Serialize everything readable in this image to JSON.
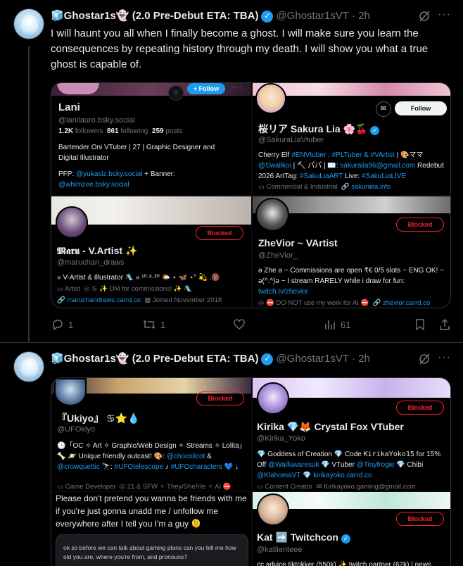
{
  "tweets": [
    {
      "display_name": "🧊Ghostar1s👻 (2.0 Pre-Debut ETA: TBA)",
      "handle": "@Ghostar1sVT",
      "time": "· 2h",
      "text": "I will haunt you all when I finally become a ghost. I will make sure you learn the consequences by repeating history through my death. I will show you what a true ghost is capable of.",
      "stats": {
        "replies": "1",
        "retweets": "1",
        "likes": "",
        "views": "61"
      },
      "cards": [
        {
          "name": "Lani",
          "handle": "@lanilauro.bsky.social",
          "followers": "1.2K",
          "followers_label": "followers",
          "following": "861",
          "following_label": "following",
          "posts": "259",
          "posts_label": "posts",
          "bio": "Bartender Oni VTuber | 27 | Graphic Designer and Digital Illustrator",
          "pfp_prefix": "PFP:",
          "pfp_link": "@yukaslz.bsky.social",
          "banner_prefix": "+ Banner:",
          "banner_link": "@whimzee.bsky.social",
          "follow_label": "+ Follow"
        },
        {
          "name": "桜リア Sakura Lia 🌸🍒",
          "handle": "@SakuraLiaVtuber",
          "bio_a": "Cherry Elf ",
          "tags_1": "#ENVtuber , #PLTuber & #VArtist",
          "bio_b": " | 🎨ママ ",
          "link_1": "@Swallkoi",
          "bio_c": " | 🔨 パパ | ✉️: ",
          "email": "sakuralia96@gmail.com",
          "bio_d": " Redebut 2026 ArtTag: ",
          "tags_2": "#SakuLiaART",
          "bio_e": " Live: ",
          "tags_3": "#SakuLiaLIVE",
          "meta_1": "Commercial & Industrial",
          "meta_2": "sakuralia.info",
          "follow_label": "Follow"
        },
        {
          "name": "𝕸𝖆𝖗𝖚 - V.Artist ✨",
          "handle": "@maruchan_draws",
          "bio": "» V-Artist & Illustrator 🛝 » ¹⁰·⁶·²⁰ 🌤️ ⋆ 🦋 ⋆° 💫 .🔞",
          "meta_1": "Artist",
          "meta_2": "♋ ✨ DM for commissions! ✨ 🛝",
          "meta_3": "maruchandraws.carrd.co",
          "meta_4": "Joined November 2018",
          "blocked_label": "Blocked"
        },
        {
          "name": "ZheVior ~ VArtist",
          "handle": "@ZheVior_",
          "bio_a": "ə Zhe ə ~ Commissions are open ₹€ 0/5 slots ~ ENG OK! ~ ə(^.^)ə ~ I stream RARELY while i draw for fun: ",
          "bio_link": "twitch.tv/zhevior",
          "meta_1": "⛔ DO NOT use my work for AI ⛔",
          "meta_2": "zhevior.carrd.co",
          "blocked_label": "Blocked"
        }
      ]
    },
    {
      "display_name": "🧊Ghostar1s👻 (2.0 Pre-Debut ETA: TBA)",
      "handle": "@Ghostar1sVT",
      "time": "· 2h",
      "cards": [
        {
          "name": "『Ukiyo』 ♋⭐💧",
          "handle": "@UFOkiyo",
          "bio_a": "🕒「OC ✧ Art ✧ Graphic/Web Design ✧ Streams ✧ Lolita」 🦴 🪐 Unique friendly outcast! 🎨: ",
          "link_1": "@chocolicot",
          "bio_b": " & ",
          "link_2": "@crowquettic",
          "bio_c": " 🔭: ",
          "tags_1": "#UFOtelescope",
          "bio_d": " ♪ ",
          "tags_2": "#UFOcharacters",
          "bio_e": " 💙 ↓",
          "meta_1": "Game Developer",
          "meta_2": "21 & SFW ✧ They/She/He ✧ AI ⛔",
          "blocked_label": "Blocked"
        },
        {
          "name": "Kirika 💎🦊 Crystal Fox VTuber",
          "handle": "@Kirika_Yoko",
          "bio_a": "💎 Goddess of Creation 💎 Code ",
          "code": "KirikaYoko15",
          "bio_b": " for 15% Off ",
          "link_1": "@Waifuwaresuk",
          "bio_c": " 💎 VTuber ",
          "link_2": "@Tinyfrogie",
          "bio_d": " 💎 Chibi ",
          "link_3": "@KlahomaVT",
          "bio_e": " 💎 ",
          "link_4": "kirikayoko.carrd.co",
          "meta_1": "Content Creator",
          "meta_2": "Kirikayoko.gaming@gmail.com",
          "blocked_label": "Blocked"
        },
        {
          "text": "Please don't pretend you wanna be friends with me if you're just gonna unadd me / unfollow me everywhere after I tell you I'm a guy 🫠",
          "quote": "ok so before we can talk about gaming plans can you tell me how old you are, where you're from, and pronouns?"
        },
        {
          "name": "Kat ➡️ Twitchcon",
          "handle": "@katlienteee",
          "bio": "cc advice tiktokker (550k) ✨ twitch partner (62k) | news",
          "blocked_label": "Blocked"
        }
      ]
    }
  ]
}
